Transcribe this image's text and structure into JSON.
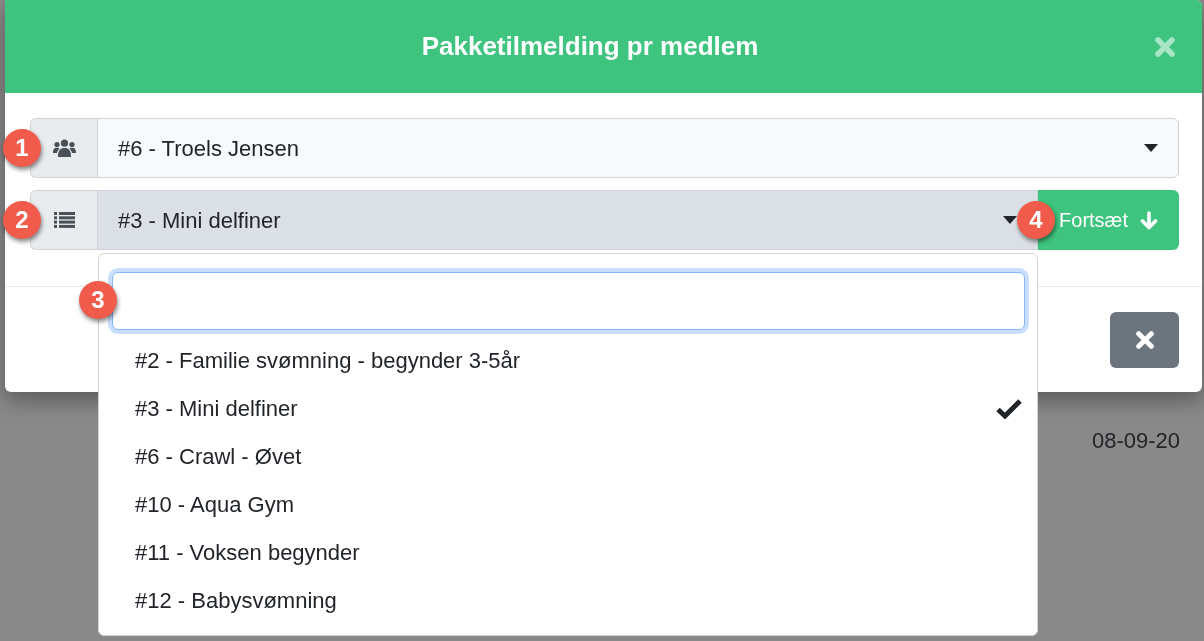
{
  "dialog": {
    "title": "Pakketilmelding pr medlem",
    "member_select": {
      "marker": "1",
      "value": "#6 - Troels Jensen",
      "open": false
    },
    "package_select": {
      "marker": "2",
      "value": "#3 - Mini delfiner",
      "open": true,
      "search": {
        "marker": "3"
      },
      "options": [
        {
          "label": "#2 - Familie svømning - begynder 3-5år",
          "selected": false
        },
        {
          "label": "#3 - Mini delfiner",
          "selected": true
        },
        {
          "label": "#6 - Crawl - Øvet",
          "selected": false
        },
        {
          "label": "#10 - Aqua Gym",
          "selected": false
        },
        {
          "label": "#11 - Voksen begynder",
          "selected": false
        },
        {
          "label": "#12 - Babysvømning",
          "selected": false
        }
      ]
    },
    "continue_button": {
      "marker": "4",
      "label": "Fortsæt"
    }
  },
  "background": {
    "date": "08-09-20"
  }
}
